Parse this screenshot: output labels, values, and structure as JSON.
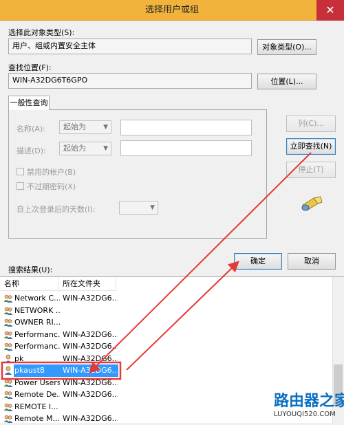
{
  "window": {
    "title": "选择用户或组",
    "close_glyph": "✕"
  },
  "object_type": {
    "label": "选择此对象类型(S):",
    "value": "用户、组或内置安全主体",
    "button": "对象类型(O)..."
  },
  "location": {
    "label": "查找位置(F):",
    "value": "WIN-A32DG6T6GPO",
    "button": "位置(L)..."
  },
  "general_query": {
    "tab": "一般性查询",
    "name_label": "名称(A):",
    "name_mode": "起始为",
    "desc_label": "描述(D):",
    "desc_mode": "起始为",
    "disabled_accounts": "禁用的帐户(B)",
    "non_expiring_pw": "不过期密码(X)",
    "days_since_login": "自上次登录后的天数(I):"
  },
  "side_buttons": {
    "columns": "列(C)...",
    "find_now": "立即查找(N)",
    "stop": "停止(T)"
  },
  "dialog_buttons": {
    "ok": "确定",
    "cancel": "取消"
  },
  "results": {
    "label": "搜索结果(U):",
    "columns": [
      "名称",
      "所在文件夹"
    ],
    "rows": [
      {
        "name": "Network C...",
        "folder": "WIN-A32DG6...",
        "icon": "group-icon"
      },
      {
        "name": "NETWORK ...",
        "folder": "",
        "icon": "group-icon"
      },
      {
        "name": "OWNER RI...",
        "folder": "",
        "icon": "group-icon"
      },
      {
        "name": "Performanc...",
        "folder": "WIN-A32DG6...",
        "icon": "group-icon"
      },
      {
        "name": "Performanc...",
        "folder": "WIN-A32DG6...",
        "icon": "group-icon"
      },
      {
        "name": "pk",
        "folder": "WIN-A32DG6...",
        "icon": "user-icon"
      },
      {
        "name": "pkaust8",
        "folder": "WIN-A32DG6...",
        "icon": "user-icon",
        "selected": true
      },
      {
        "name": "Power Users",
        "folder": "WIN-A32DG6...",
        "icon": "group-icon"
      },
      {
        "name": "Remote De...",
        "folder": "WIN-A32DG6...",
        "icon": "group-icon"
      },
      {
        "name": "REMOTE I...",
        "folder": "",
        "icon": "group-icon"
      },
      {
        "name": "Remote M...",
        "folder": "WIN-A32DG6...",
        "icon": "group-icon"
      }
    ]
  },
  "watermark": {
    "logo": "路由器之家",
    "url": "LUYOUQI520.COM"
  },
  "colors": {
    "titlebar": "#f2b33d",
    "close": "#c7303a",
    "selection": "#3399ff",
    "annotation": "#e53935"
  }
}
